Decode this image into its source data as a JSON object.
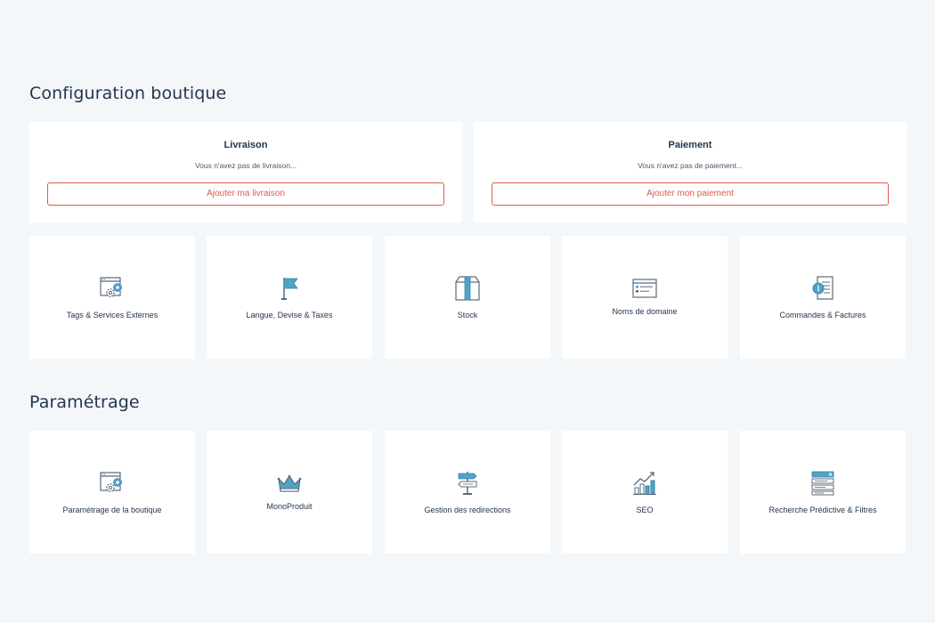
{
  "sections": {
    "config_title": "Configuration boutique",
    "param_title": "Paramétrage"
  },
  "delivery": {
    "title": "Livraison",
    "subtitle": "Vous n'avez pas de livraison...",
    "button": "Ajouter ma livraison"
  },
  "payment": {
    "title": "Paiement",
    "subtitle": "Vous n'avez pas de paiement...",
    "button": "Ajouter mon paiement"
  },
  "config_tiles": [
    {
      "label": "Tags & Services Externes",
      "icon": "window-gear-icon"
    },
    {
      "label": "Langue, Devise & Taxes",
      "icon": "flag-icon"
    },
    {
      "label": "Stock",
      "icon": "box-icon"
    },
    {
      "label": "Noms de domaine",
      "icon": "browser-window-icon"
    },
    {
      "label": "Commandes & Factures",
      "icon": "invoice-coin-icon"
    }
  ],
  "param_tiles": [
    {
      "label": "Paramétrage de la boutique",
      "icon": "window-gear-icon"
    },
    {
      "label": "MonoProduit",
      "icon": "crown-icon"
    },
    {
      "label": "Gestion des redirections",
      "icon": "signpost-icon"
    },
    {
      "label": "SEO",
      "icon": "growth-chart-icon"
    },
    {
      "label": "Recherche Prédictive & Filtres",
      "icon": "search-filter-list-icon"
    }
  ],
  "colors": {
    "background": "#f4f7fa",
    "card": "#ffffff",
    "text": "#23364d",
    "accent_red": "#e2584f",
    "icon_blue": "#4fa3c7",
    "icon_gray": "#5b6b7b"
  }
}
